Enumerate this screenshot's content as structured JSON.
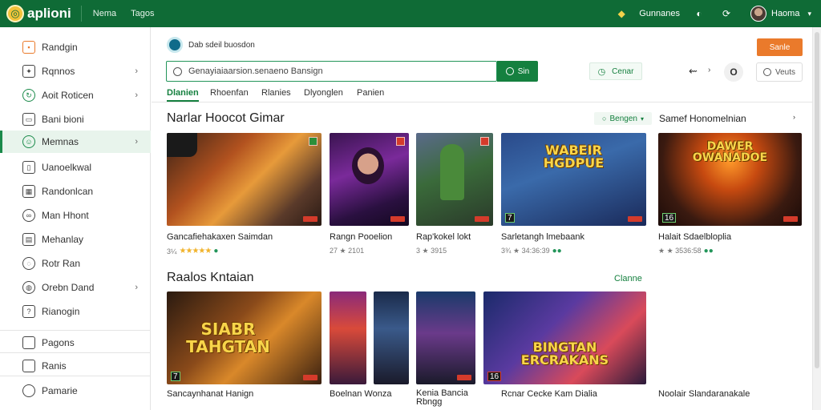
{
  "app": {
    "logo_text": "aplioni",
    "nav": [
      "Nema",
      "Tagos"
    ]
  },
  "topbar_right": {
    "account_label": "Gunnanes",
    "user_name": "Haoma"
  },
  "sidebar": {
    "items": [
      {
        "label": "Randgin",
        "has_arrow": false,
        "icon": "grid-icon"
      },
      {
        "label": "Rqnnos",
        "has_arrow": true,
        "icon": "puzzle-icon"
      },
      {
        "label": "Aoit Roticen",
        "has_arrow": true,
        "icon": "refresh-icon"
      },
      {
        "label": "Bani bioni",
        "has_arrow": false,
        "icon": "chat-icon"
      },
      {
        "label": "Memnas",
        "has_arrow": true,
        "icon": "users-icon",
        "active": true
      },
      {
        "label": "Uanoelkwal",
        "has_arrow": false,
        "icon": "document-icon"
      },
      {
        "label": "Randonlcan",
        "has_arrow": false,
        "icon": "calendar-icon"
      },
      {
        "label": "Man Hhont",
        "has_arrow": false,
        "icon": "link-icon"
      },
      {
        "label": "Mehanlay",
        "has_arrow": false,
        "icon": "table-icon"
      },
      {
        "label": "Rotr Ran",
        "has_arrow": false,
        "icon": "chat-icon"
      },
      {
        "label": "Orebn Dand",
        "has_arrow": true,
        "icon": "globe-icon"
      },
      {
        "label": "Rianogin",
        "has_arrow": false,
        "icon": "note-icon"
      }
    ],
    "footer_items": [
      {
        "label": "Pagons",
        "icon": "page-icon"
      },
      {
        "label": "Ranis",
        "icon": "page-icon"
      },
      {
        "label": "Pamarie",
        "icon": "search-icon"
      }
    ]
  },
  "subheader": {
    "title": "Dab sdeil buosdon",
    "action_label": "Sanle"
  },
  "search": {
    "value": "Genayiaiaarsion.senaeno Bansign",
    "button_label": "Sin"
  },
  "toolbar": {
    "filter_label": "Cenar",
    "circle_label": "O",
    "views_label": "Veuts"
  },
  "tabs": [
    {
      "label": "Dlanien",
      "active": true
    },
    {
      "label": "Rhoenfan",
      "active": false
    },
    {
      "label": "Rlanies",
      "active": false
    },
    {
      "label": "Dlyonglen",
      "active": false
    },
    {
      "label": "Panien",
      "active": false
    }
  ],
  "sections": [
    {
      "title": "Narlar Hoocot Gimar",
      "filter_pill": "Bengen",
      "side_title": "Samef Honomelnian",
      "cards": [
        {
          "title": "Gancafiehakaxen Saimdan",
          "meta": "3¼",
          "stars": "★★★★★",
          "dots": "●"
        },
        {
          "title": "Rangn Pooelion",
          "meta": "27 ★ 2101",
          "stars": "",
          "dots": ""
        },
        {
          "title": "Rap'kokel lokt",
          "meta": "3 ★ 3915",
          "stars": "",
          "dots": ""
        },
        {
          "title": "Sarletangh lmebaank",
          "meta": "3¾ ★ 34:36:39",
          "stars": "",
          "dots": "●●"
        },
        {
          "title": "Halait Sdaelbloplia",
          "meta": "★ ★ 3536:58",
          "stars": "",
          "dots": "●●"
        }
      ]
    },
    {
      "title": "Raalos Kntaian",
      "see_all": "Clanne",
      "cards": [
        {
          "title": "Sancaynhanat Hanign",
          "meta": "",
          "stars": "",
          "dots": ""
        },
        {
          "title": "Boelnan Wonza",
          "meta": "",
          "stars": "",
          "dots": ""
        },
        {
          "title": "Kenia Bancia Rbngg",
          "meta": "",
          "stars": "",
          "dots": ""
        },
        {
          "title": "Rcnar Cecke Kam Dialia",
          "meta": "",
          "stars": "",
          "dots": ""
        },
        {
          "title": "Noolair Slandaranakale",
          "meta": "",
          "stars": "",
          "dots": ""
        }
      ]
    }
  ],
  "card_overlays": {
    "r1c4": "WABEIR HGDPUE",
    "r1c5": "DAWER OWANADOE",
    "r2c1": "SIABR TAHGTAN",
    "r2c4": "BINGTAN ERCRAKANS",
    "r1c5_badge": "16",
    "r2c4_badge": "16",
    "r1c4_badge": "7",
    "r2c1_badge": "7"
  },
  "colors": {
    "brand_green": "#0f6b36",
    "accent_orange": "#ea7a2b",
    "star": "#f1b32b"
  }
}
